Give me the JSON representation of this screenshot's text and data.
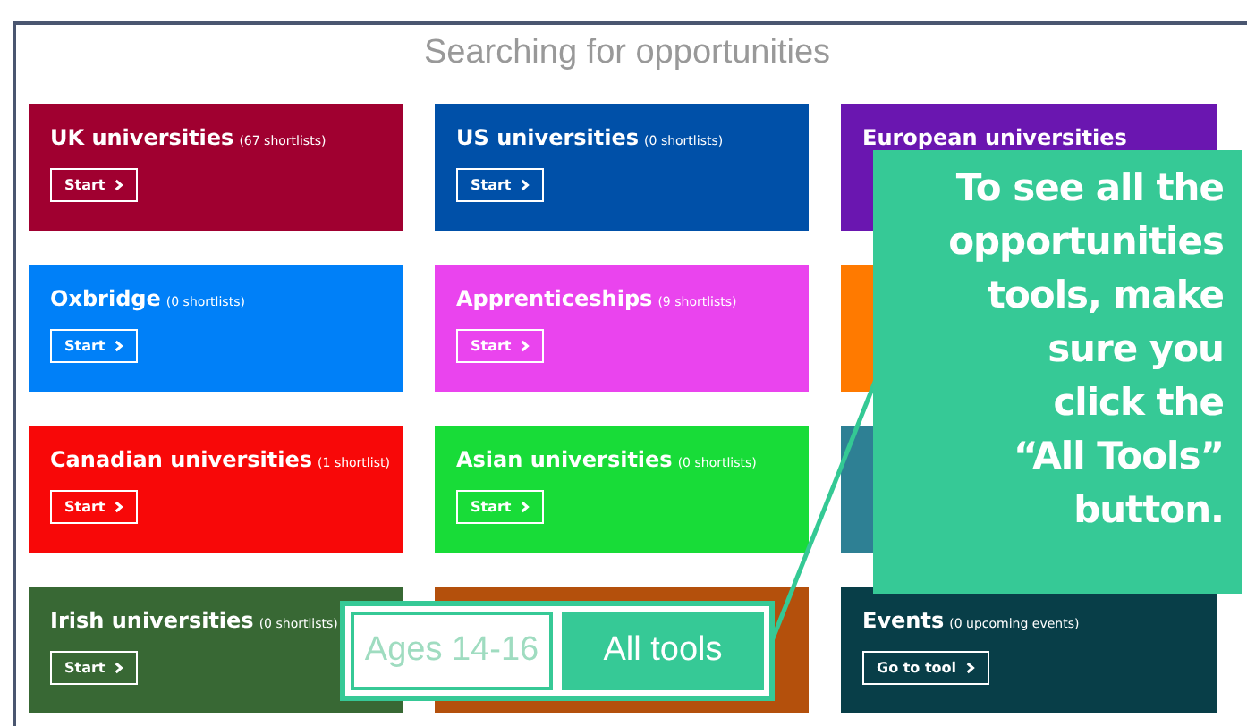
{
  "page": {
    "title": "Searching for opportunities"
  },
  "cards": [
    {
      "title": "UK universities",
      "count": "(67 shortlists)",
      "button": "Start",
      "color": "#a00030"
    },
    {
      "title": "US universities",
      "count": "(0 shortlists)",
      "button": "Start",
      "color": "#0050a8"
    },
    {
      "title": "European universities",
      "color": "#6a16b0"
    },
    {
      "title": "Oxbridge",
      "count": "(0 shortlists)",
      "button": "Start",
      "color": "#0080f8"
    },
    {
      "title": "Apprenticeships",
      "count": "(9 shortlists)",
      "button": "Start",
      "color": "#ea44ee"
    },
    {
      "color": "#ff7a00"
    },
    {
      "title": "Canadian universities",
      "count": "(1 shortlist)",
      "button": "Start",
      "color": "#f80808"
    },
    {
      "title": "Asian universities",
      "count": "(0 shortlists)",
      "button": "Start",
      "color": "#18dc38"
    },
    {
      "color": "#2e8094"
    },
    {
      "title": "Irish universities",
      "count": "(0 shortlists)",
      "button": "Start",
      "color": "#386834"
    },
    {
      "color": "#b4500c"
    },
    {
      "title": "Events",
      "count": "(0 upcoming events)",
      "button": "Go to tool",
      "color": "#083e48"
    }
  ],
  "callout": {
    "text": "To see all the\nopportunities\ntools, make\nsure you\nclick the\n“All Tools”\nbutton."
  },
  "age_tabs": [
    {
      "label": "Ages 14-16",
      "selected": false
    },
    {
      "label": "All tools",
      "selected": true
    }
  ]
}
